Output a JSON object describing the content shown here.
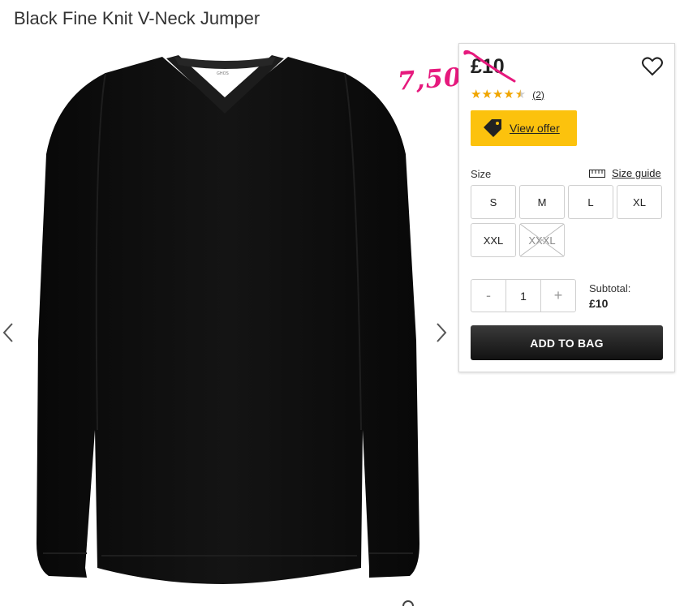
{
  "product": {
    "title": "Black Fine Knit V-Neck Jumper",
    "image_alt": "Black fine knit V-neck jumper",
    "neck_label": "GHOS"
  },
  "gallery": {
    "prev_icon": "chevron-left-icon",
    "next_icon": "chevron-right-icon"
  },
  "pricing": {
    "price": "£10",
    "sale_annotation": "7,50",
    "annotation_color": "#e6197d"
  },
  "rating": {
    "stars": 4.5,
    "stars_text": "★★★★",
    "half_star": "★",
    "count": "(2)"
  },
  "offer": {
    "label": "View offer",
    "color": "#fcc20d"
  },
  "size": {
    "label": "Size",
    "guide_label": "Size guide",
    "options": [
      {
        "label": "S",
        "available": true
      },
      {
        "label": "M",
        "available": true
      },
      {
        "label": "L",
        "available": true
      },
      {
        "label": "XL",
        "available": true
      },
      {
        "label": "XXL",
        "available": true
      },
      {
        "label": "XXXL",
        "available": false
      }
    ]
  },
  "quantity": {
    "minus": "-",
    "value": "1",
    "plus": "+"
  },
  "subtotal": {
    "label": "Subtotal:",
    "value": "£10"
  },
  "cart": {
    "add_label": "ADD TO BAG"
  }
}
